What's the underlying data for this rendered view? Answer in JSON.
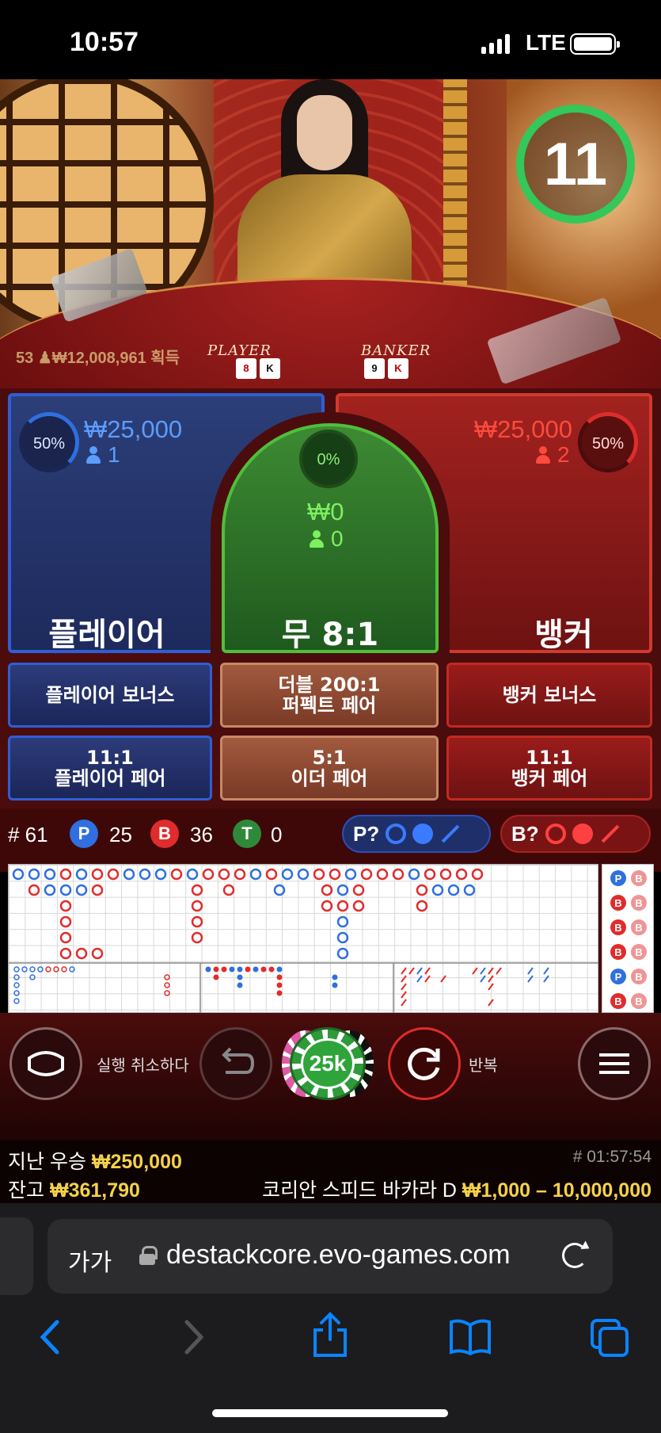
{
  "status_bar": {
    "time": "10:57",
    "network": "LTE"
  },
  "video": {
    "win_line": "53 ♟₩12,008,961 획득",
    "player_label": "PLAYER",
    "banker_label": "BANKER",
    "player_cards": [
      "8",
      "K"
    ],
    "banker_cards": [
      "9",
      "K"
    ],
    "timer": "11"
  },
  "bets": {
    "player": {
      "pct": "50%",
      "amount": "₩25,000",
      "players": "1",
      "label": "플레이어"
    },
    "tie": {
      "pct": "0%",
      "amount": "₩0",
      "players": "0",
      "label": "무 8:1"
    },
    "banker": {
      "pct": "50%",
      "amount": "₩25,000",
      "players": "2",
      "label": "뱅커"
    }
  },
  "side_bets": {
    "player_bonus": "플레이어 보너스",
    "perfect_pair_line1": "더블 200:1",
    "perfect_pair_line2": "퍼펙트 페어",
    "banker_bonus": "뱅커 보너스",
    "player_pair_line1": "11:1",
    "player_pair_line2": "플레이어 페어",
    "either_pair_line1": "5:1",
    "either_pair_line2": "이더 페어",
    "banker_pair_line1": "11:1",
    "banker_pair_line2": "뱅커 페어"
  },
  "stats": {
    "round": "# 61",
    "p_letter": "P",
    "p_count": "25",
    "b_letter": "B",
    "b_count": "36",
    "t_letter": "T",
    "t_count": "0",
    "p_predict": "P?",
    "b_predict": "B?"
  },
  "roadmap_side": [
    "P",
    "B",
    "B",
    "B",
    "P",
    "B"
  ],
  "controls": {
    "undo_label": "실행 취소하다",
    "chip_value": "25k",
    "repeat_label": "반복"
  },
  "info": {
    "last_win_label": "지난 우승",
    "last_win_value": "₩250,000",
    "balance_label": "잔고",
    "balance_value": "₩361,790",
    "round_time": "# 01:57:54",
    "table_name": "코리안 스피드 바카라 D",
    "limits": "₩1,000 – 10,000,000"
  },
  "browser": {
    "aa": "가가",
    "url": "destackcore.evo-games.com"
  },
  "colors": {
    "player_blue": "#2f5ed6",
    "banker_red": "#d13a2e",
    "tie_green": "#4fbf3b",
    "gold": "#f5d24a",
    "ios_blue": "#0a84ff"
  }
}
